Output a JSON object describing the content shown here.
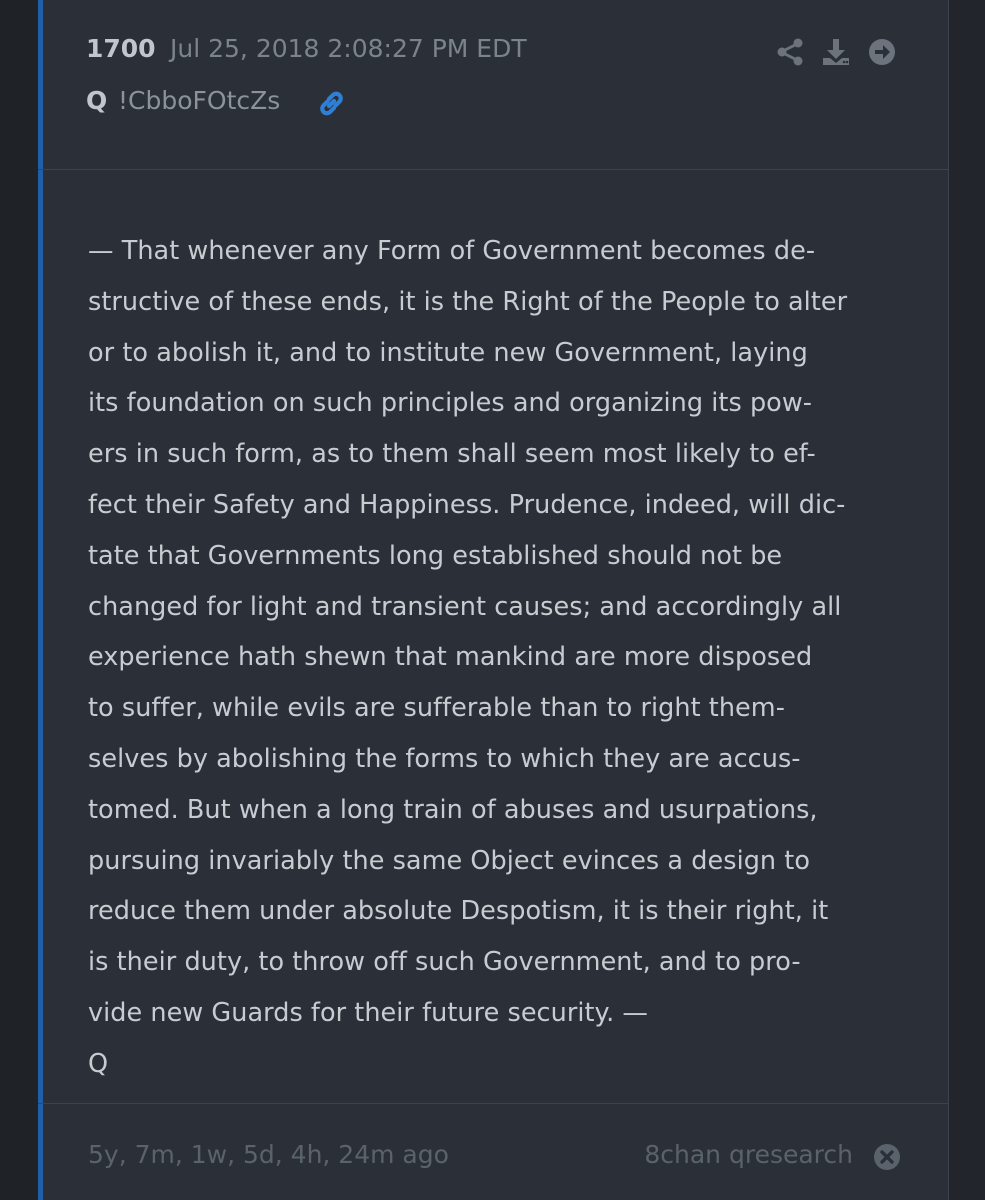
{
  "post": {
    "number": "1700",
    "date": "Jul 25, 2018 2:08:27 PM EDT",
    "author": "Q",
    "tripcode": "!CbboFOtcZs",
    "message": "— That whenever any Form of Government becomes de-\nstructive of these ends, it is the Right of the People to alter\nor to abolish it, and to institute new Government, laying\nits foundation on such principles and organizing its pow-\ners in such form, as to them shall seem most likely to ef-\nfect their Safety and Happiness. Prudence, indeed, will dic-\ntate that Governments long established should not be\nchanged for light and transient causes; and accordingly all\nexperience hath shewn that mankind are more disposed\nto suffer, while evils are sufferable than to right them-\nselves by abolishing the forms to which they are accus-\ntomed. But when a long train of abuses and usurpations,\npursuing invariably the same Object evinces a design to\nreduce them under absolute Despotism, it is their right, it\nis their duty, to throw off such Government, and to pro-\nvide new Guards for their future security. —\nQ"
  },
  "footer": {
    "relative_time": "5y, 7m, 1w, 5d, 4h, 24m ago",
    "source": "8chan qresearch"
  },
  "icons": {
    "link": "link-icon",
    "share": "share-icon",
    "download": "download-icon",
    "goto": "arrow-right-circle-icon",
    "close": "close-circle-icon"
  },
  "colors": {
    "background": "#22262c",
    "card": "#2b3038",
    "accent": "#1f5fa8",
    "link_icon": "#2f7fd6",
    "body_text": "#c8ccd1",
    "muted_text": "#5a626c"
  }
}
